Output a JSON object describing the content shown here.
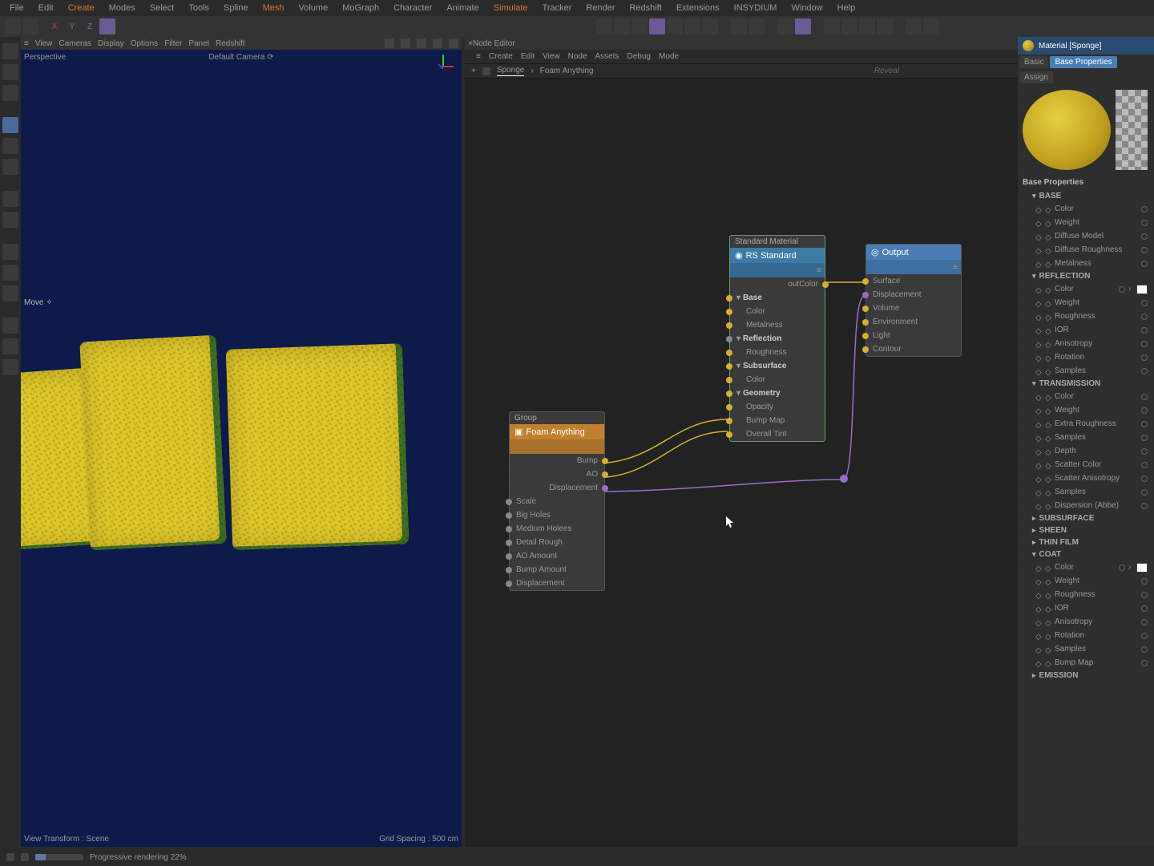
{
  "menu": [
    "File",
    "Edit",
    "Create",
    "Modes",
    "Select",
    "Tools",
    "Spline",
    "Mesh",
    "Volume",
    "MoGraph",
    "Character",
    "Animate",
    "Simulate",
    "Tracker",
    "Render",
    "Redshift",
    "Extensions",
    "INSYDIUM",
    "Window",
    "Help"
  ],
  "menu_orange_indices": [
    2,
    7,
    12
  ],
  "axes": {
    "x": "X",
    "y": "Y",
    "z": "Z"
  },
  "viewport": {
    "menu": [
      "≡",
      "View",
      "Cameras",
      "Display",
      "Options",
      "Filter",
      "Panel",
      "Redshift"
    ],
    "label_tl": "Perspective",
    "label_tc": "Default Camera ⟳",
    "move": "Move  ✧",
    "bl": "View Transform : Scene",
    "br": "Grid Spacing : 500 cm"
  },
  "node_editor": {
    "tab": "Node Editor",
    "menu": [
      "≡",
      "Create",
      "Edit",
      "View",
      "Node",
      "Assets",
      "Debug",
      "Mode"
    ],
    "crumb": {
      "root": "Sponge",
      "sep": "›",
      "current": "Foam Anything",
      "reveal": "Reveal"
    }
  },
  "nodes": {
    "foam": {
      "title": "Group",
      "name": "Foam Anything",
      "outputs": [
        "Bump",
        "AO",
        "Displacement"
      ],
      "inputs": [
        "Scale",
        "Big Holes",
        "Medium Holees",
        "Detail Rough",
        "AO Amount",
        "Bump Amount",
        "Displacement"
      ]
    },
    "std": {
      "title": "Standard Material",
      "name": "RS Standard",
      "out": "outColor",
      "groups": [
        {
          "name": "Base",
          "items": [
            "Color",
            "Metalness"
          ]
        },
        {
          "name": "Reflection",
          "items": [
            "Roughness"
          ]
        },
        {
          "name": "Subsurface",
          "items": [
            "Color"
          ]
        },
        {
          "name": "Geometry",
          "items": [
            "Opacity",
            "Bump Map",
            "Overall Tint"
          ]
        }
      ]
    },
    "output": {
      "name": "Output",
      "items": [
        "Surface",
        "Displacement",
        "Volume",
        "Environment",
        "Light",
        "Contour"
      ]
    }
  },
  "attr": {
    "title": "Material [Sponge]",
    "tabs": [
      "Basic",
      "Base Properties"
    ],
    "assign": "Assign",
    "section": "Base Properties",
    "groups": [
      {
        "name": "BASE",
        "open": true,
        "rows": [
          "Color",
          "Weight",
          "Diffuse Model",
          "Diffuse Roughness",
          "Metalness"
        ]
      },
      {
        "name": "REFLECTION",
        "open": true,
        "rows": [
          "Color",
          "Weight",
          "Roughness",
          "IOR",
          "Anisotropy",
          "Rotation",
          "Samples"
        ]
      },
      {
        "name": "TRANSMISSION",
        "open": true,
        "rows": [
          "Color",
          "Weight",
          "Extra Roughness",
          "Samples",
          "Depth",
          "Scatter Color",
          "Scatter Anisotropy",
          "Samples",
          "Dispersion (Abbe)"
        ]
      },
      {
        "name": "SUBSURFACE",
        "open": false,
        "rows": []
      },
      {
        "name": "SHEEN",
        "open": false,
        "rows": []
      },
      {
        "name": "THIN FILM",
        "open": false,
        "rows": []
      },
      {
        "name": "COAT",
        "open": true,
        "rows": [
          "Color",
          "Weight",
          "Roughness",
          "IOR",
          "Anisotropy",
          "Rotation",
          "Samples",
          "Bump Map"
        ]
      },
      {
        "name": "EMISSION",
        "open": false,
        "rows": []
      }
    ]
  },
  "status": {
    "text": "Progressive rendering 22%"
  }
}
